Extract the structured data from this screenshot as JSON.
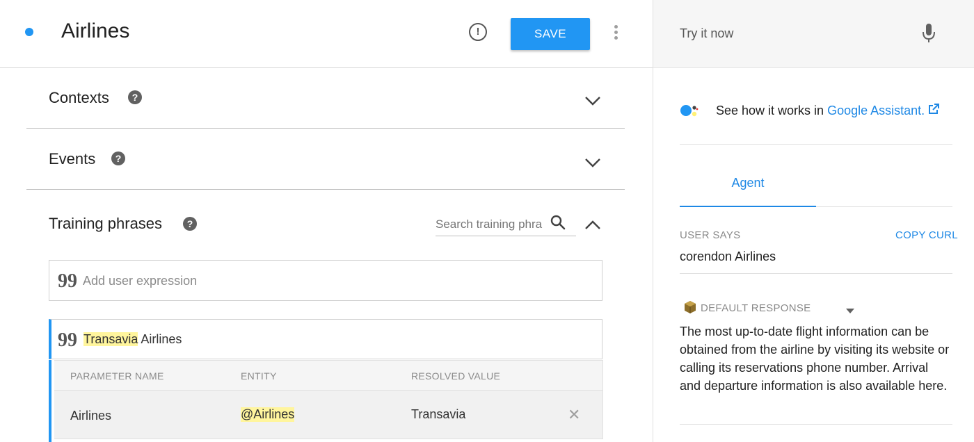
{
  "header": {
    "title": "Airlines",
    "save_label": "SAVE",
    "info_glyph": "!"
  },
  "sections": {
    "contexts": {
      "title": "Contexts",
      "help_glyph": "?"
    },
    "events": {
      "title": "Events",
      "help_glyph": "?"
    },
    "training": {
      "title": "Training phrases",
      "help_glyph": "?",
      "search_placeholder": "Search training phra"
    }
  },
  "add_expression": {
    "quote_glyph": "99",
    "placeholder": "Add user expression"
  },
  "phrases": [
    {
      "quote_glyph": "99",
      "highlighted": "Transavia",
      "rest": " Airlines"
    }
  ],
  "parameters": {
    "headers": [
      "PARAMETER NAME",
      "ENTITY",
      "RESOLVED VALUE"
    ],
    "rows": [
      {
        "name": "Airlines",
        "entity": "@Airlines",
        "value": "Transavia",
        "delete_glyph": "✕"
      }
    ]
  },
  "side": {
    "try_placeholder": "Try it now",
    "ga_prefix": "See how it works in ",
    "ga_link": "Google Assistant.",
    "tab_agent": "Agent",
    "user_says_label": "USER SAYS",
    "copy_curl": "COPY CURL",
    "user_says_value": "corendon Airlines",
    "default_response_label": "DEFAULT RESPONSE",
    "response_text": "The most up-to-date flight information can be obtained from the airline by visiting its website or calling its reservations phone number. Arrival and departure information is also available here."
  },
  "colors": {
    "accent": "#2196f3",
    "highlight": "#fff59d",
    "link": "#1e88e5"
  },
  "icons": [
    "intent-dot-icon",
    "alert-info-icon",
    "more-vert-icon",
    "help-icon",
    "chevron-down-icon",
    "chevron-up-icon",
    "search-icon",
    "quote-icon",
    "close-icon",
    "mic-icon",
    "google-assistant-icon",
    "external-link-icon",
    "response-cube-icon",
    "dropdown-caret-icon"
  ]
}
